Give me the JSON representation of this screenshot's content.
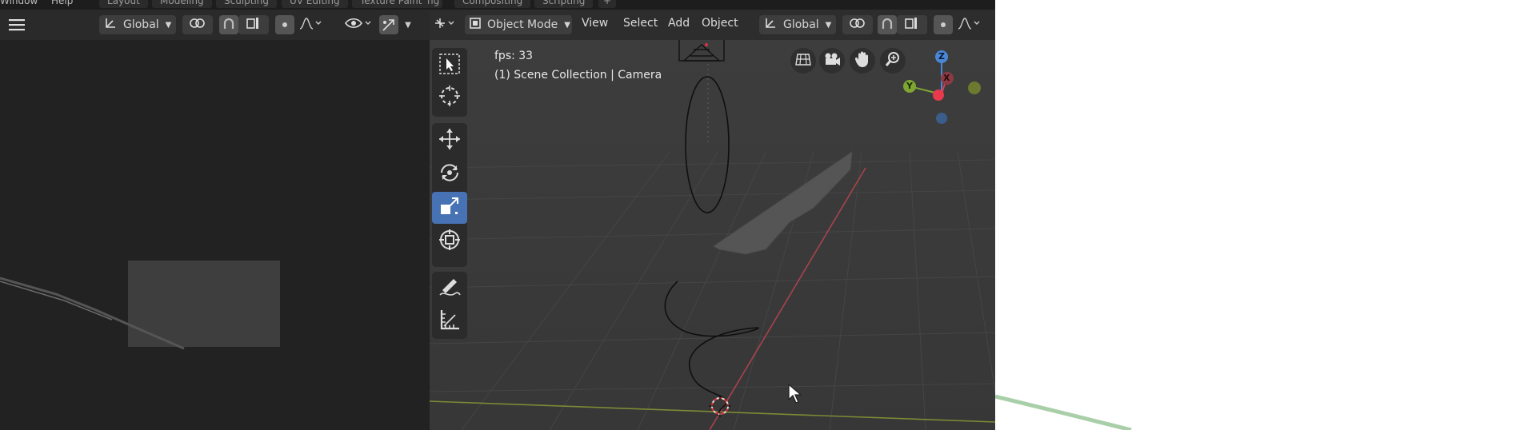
{
  "topbar": {
    "menus": [
      "Window",
      "Help"
    ],
    "tabs": [
      "Layout",
      "Modeling",
      "Sculpting",
      "UV Editing",
      "Texture Paint",
      "ng",
      "Compositing",
      "Scripting"
    ],
    "add_tab": "+"
  },
  "left_header": {
    "transform_orientation": "Global"
  },
  "viewport_header": {
    "mode": "Object Mode",
    "menus": [
      "View",
      "Select",
      "Add",
      "Object"
    ],
    "transform_orientation": "Global"
  },
  "viewport_overlay": {
    "fps": "fps: 33",
    "collection": "(1) Scene Collection | Camera"
  },
  "gizmo": {
    "axes": {
      "x": "X",
      "y": "Y",
      "z": "Z"
    },
    "colors": {
      "x": "#e8394d",
      "y": "#7fa632",
      "z": "#4a87d6"
    }
  },
  "icons": {
    "toolbar": [
      "select-box-icon",
      "cursor-icon",
      "move-icon",
      "rotate-icon",
      "scale-icon",
      "transform-icon",
      "annotate-icon",
      "measure-icon"
    ],
    "nav": [
      "grid-icon",
      "camera-icon",
      "hand-icon",
      "zoom-icon"
    ]
  },
  "colors": {
    "active_tool": "#4772b3",
    "viewport_bg": "#3a3a3a",
    "header_bg": "#2d2d2d"
  }
}
